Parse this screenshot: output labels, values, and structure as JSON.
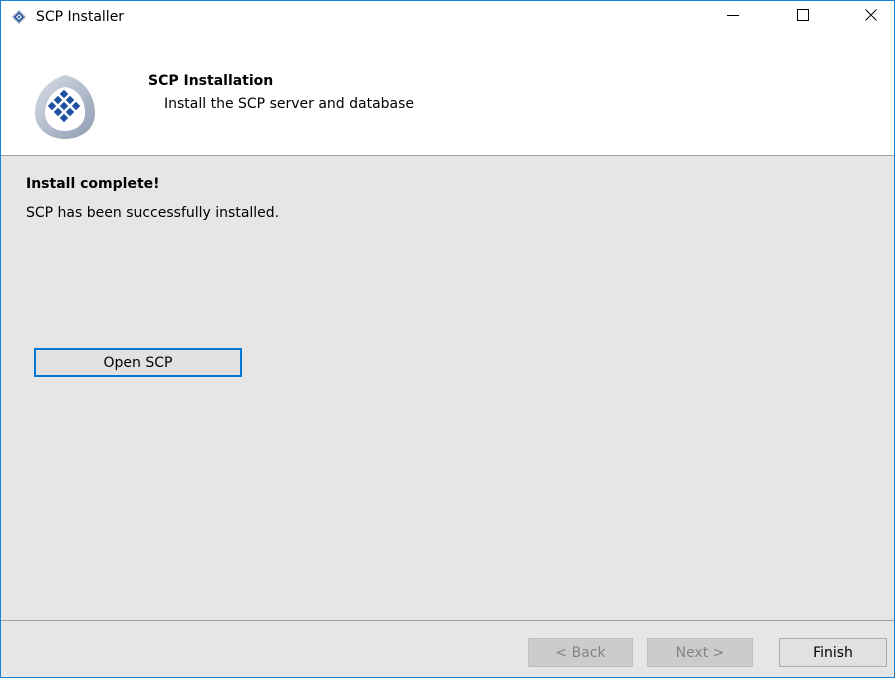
{
  "window": {
    "title": "SCP Installer",
    "icon": "scp-logo-icon",
    "controls": {
      "minimize_icon": "minimize-icon",
      "maximize_icon": "maximize-icon",
      "close_icon": "close-icon"
    }
  },
  "header": {
    "title": "SCP Installation",
    "subtitle": "Install the SCP server and database",
    "logo_icon": "scp-logo-icon"
  },
  "content": {
    "status_title": "Install complete!",
    "status_message": "SCP has been successfully installed.",
    "open_button_label": "Open SCP"
  },
  "footer": {
    "back_label": "< Back",
    "next_label": "Next >",
    "finish_label": "Finish",
    "back_enabled": false,
    "next_enabled": false,
    "finish_enabled": true
  },
  "colors": {
    "accent": "#0078d7",
    "window_border": "#1883d7",
    "background": "#e6e6e6",
    "logo_blue": "#1f4fa0"
  }
}
